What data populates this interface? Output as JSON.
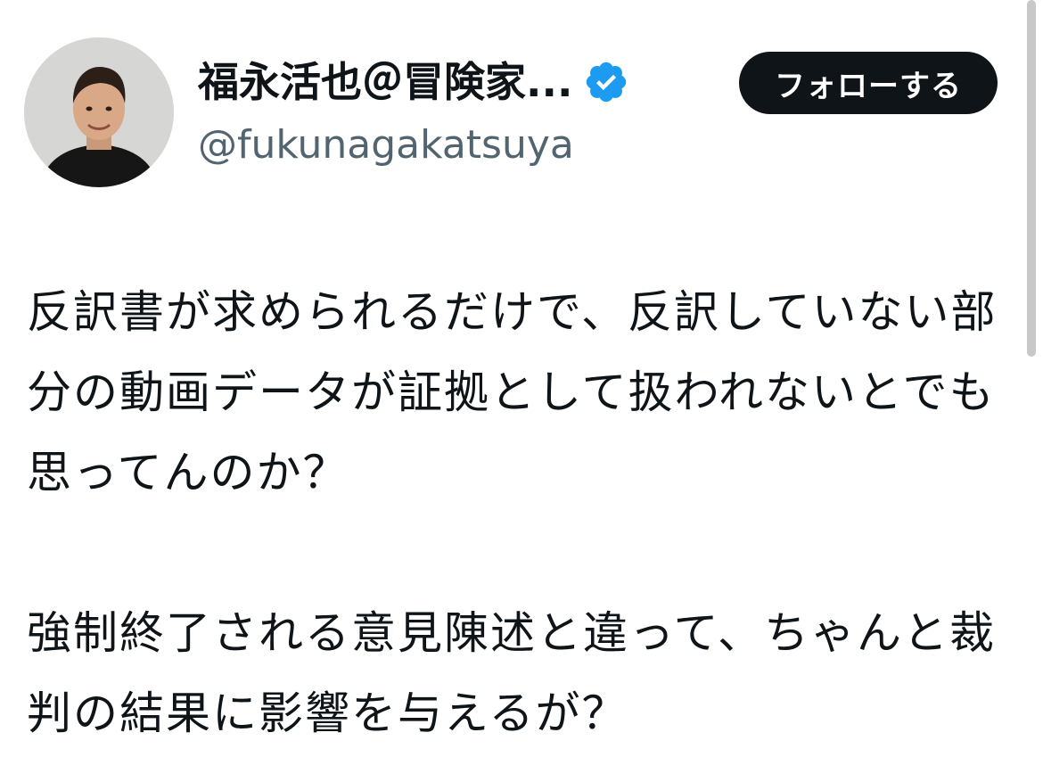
{
  "author": {
    "display_name": "福永活也＠冒険家...",
    "handle": "@fukunagakatsuya",
    "verified_icon": "verified-badge-icon",
    "avatar_icon": "profile-avatar"
  },
  "actions": {
    "follow_label": "フォローする"
  },
  "tweet": {
    "paragraph_1": "反訳書が求められるだけで、反訳していない部分の動画データが証拠として扱われないとでも思ってんのか？",
    "paragraph_2": "強制終了される意見陳述と違って、ちゃんと裁判の結果に影響を与えるが？"
  },
  "colors": {
    "verified_blue": "#1d9bf0",
    "follow_button_bg": "#0f1419",
    "handle_gray": "#536471"
  }
}
